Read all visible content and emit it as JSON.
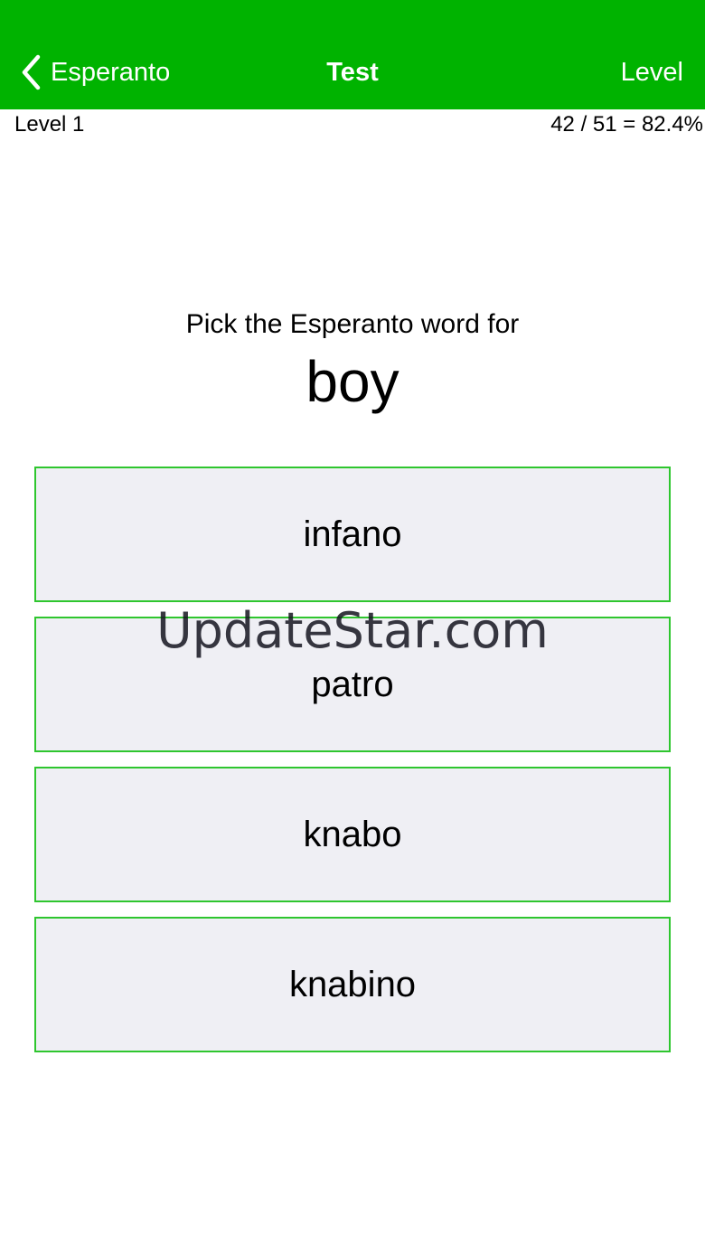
{
  "nav": {
    "back_label": "Esperanto",
    "title": "Test",
    "right_label": "Level",
    "background_color": "#00b300"
  },
  "status": {
    "level": "Level 1",
    "score": "42 / 51 = 82.4%"
  },
  "question": {
    "prompt": "Pick the Esperanto word for",
    "word": "boy"
  },
  "options": [
    {
      "label": "infano"
    },
    {
      "label": "patro"
    },
    {
      "label": "knabo"
    },
    {
      "label": "knabino"
    }
  ],
  "option_style": {
    "background": "#efeff4",
    "border_color": "#2ec62e"
  },
  "watermark": "UpdateStar.com"
}
